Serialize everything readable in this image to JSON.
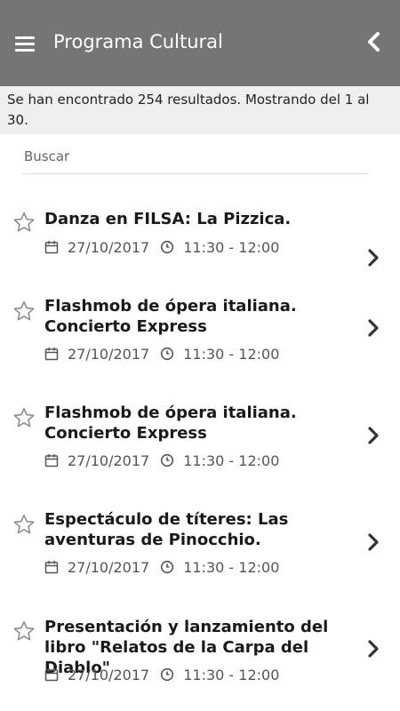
{
  "appbar": {
    "title": "Programa Cultural",
    "menu_icon": "hamburger-menu-icon",
    "back_icon": "chevron-left-icon"
  },
  "results": {
    "summary": "Se han encontrado 254 resultados. Mostrando del 1 al 30."
  },
  "search": {
    "placeholder": "Buscar",
    "value": ""
  },
  "items": [
    {
      "title": "Danza en FILSA: La Pizzica.",
      "date": "27/10/2017",
      "time": "11:30 - 12:00"
    },
    {
      "title": "Flashmob de ópera italiana. Concierto Express",
      "date": "27/10/2017",
      "time": "11:30 - 12:00"
    },
    {
      "title": "Flashmob de ópera italiana. Concierto Express",
      "date": "27/10/2017",
      "time": "11:30 - 12:00"
    },
    {
      "title": "Espectáculo de títeres: Las aventuras de Pinocchio.",
      "date": "27/10/2017",
      "time": "11:30 - 12:00"
    },
    {
      "title": "Presentación y lanzamiento del libro \"Relatos de la Carpa del Diablo\"",
      "date": "27/10/2017",
      "time": "11:30 - 12:00"
    }
  ],
  "colors": {
    "appbar_bg": "#757575",
    "info_bg": "#efefef"
  }
}
